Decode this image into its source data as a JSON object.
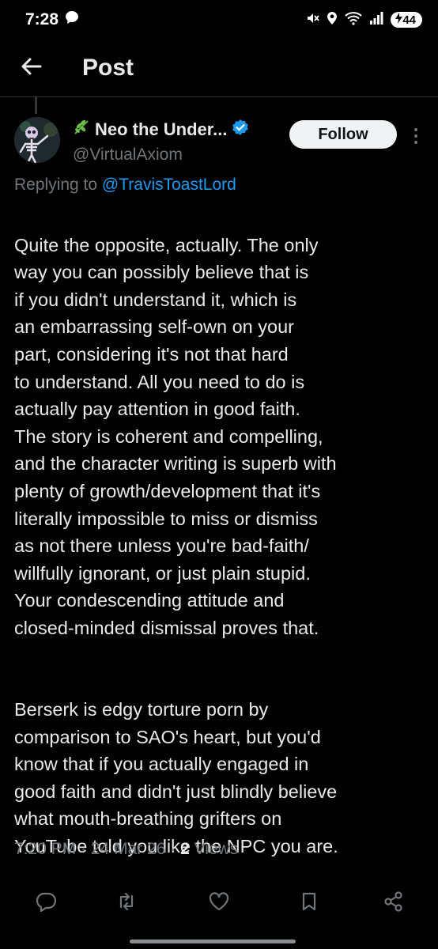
{
  "status_bar": {
    "time": "7:28",
    "battery": "44"
  },
  "header": {
    "title": "Post"
  },
  "author": {
    "name": "Neo the Under...",
    "handle": "@VirtualAxiom"
  },
  "follow_label": "Follow",
  "reply": {
    "prefix": "Replying to ",
    "mention": "@TravisToastLord"
  },
  "post": {
    "paragraph1": "Quite the opposite, actually. The only\nway you can possibly believe that is\nif you didn't understand it, which is\nan embarrassing self-own on your\npart, considering it's not that hard\nto understand. All you need to do is\nactually pay attention in good faith.\nThe story is coherent and compelling,\nand the character writing is superb with\nplenty of growth/development that it's\nliterally impossible to miss or dismiss\nas not there unless you're bad-faith/\nwillfully ignorant, or just plain stupid.\nYour condescending attitude and\nclosed-minded dismissal proves that.",
    "paragraph2": "Berserk is edgy torture porn by\ncomparison to SAO's heart, but you'd\nknow that if you actually engaged in\ngood faith and didn't just blindly believe\nwhat mouth-breathing grifters on\nYouTube told you like the NPC you are."
  },
  "meta": {
    "time": "7:20 PM",
    "sep1": " · ",
    "date": "24 Mar 26",
    "sep2": " · ",
    "views_count": "2",
    "views_label": " Views"
  },
  "icons": [
    "reply-icon",
    "retweet-icon",
    "like-icon",
    "bookmark-icon",
    "share-icon"
  ],
  "colors": {
    "accent": "#1d9bf0",
    "muted": "#71767b",
    "text": "#e7e9ea",
    "background": "#000000"
  }
}
